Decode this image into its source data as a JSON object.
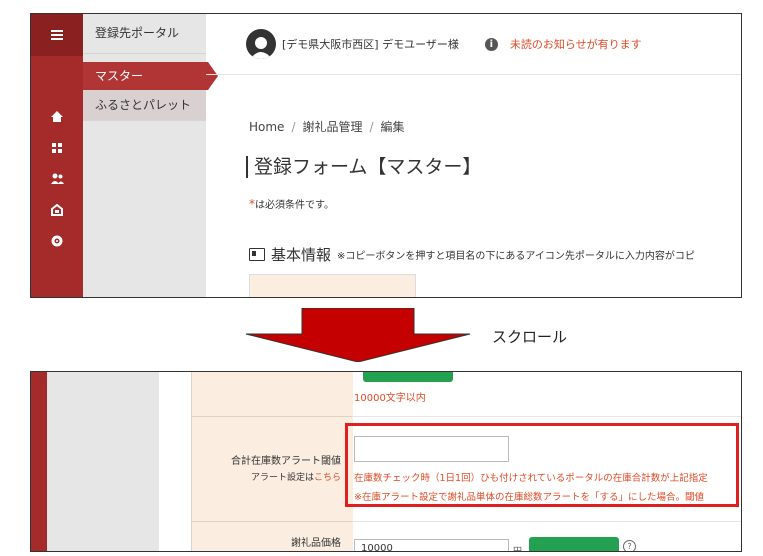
{
  "top": {
    "sidebar": {
      "portal_label": "登録先ポータル",
      "active_item": "マスター",
      "sub_item": "ふるさとパレット",
      "icons": [
        "menu-icon",
        "home-icon",
        "grid-icon",
        "users-icon",
        "portal-icon",
        "gear-icon"
      ]
    },
    "header": {
      "user_name": "[デモ県大阪市西区] デモユーザー様",
      "info_glyph": "i",
      "notice": "未読のお知らせが有ります"
    },
    "breadcrumb": {
      "home": "Home",
      "sep": "/",
      "item1": "謝礼品管理",
      "item2": "編集"
    },
    "page_title": "登録フォーム【マスター】",
    "required_star": "*",
    "required_note": "は必須条件です。",
    "section": {
      "title": "基本情報",
      "note": "※コピーボタンを押すと項目名の下にあるアイコン先ポータルに入力内容がコピ"
    }
  },
  "annotation": {
    "scroll_label": "スクロール"
  },
  "bottom": {
    "limit_text": "10000文字以内",
    "alert_field": {
      "label": "合計在庫数アラート閾値",
      "sublabel_prefix": "アラート設定は",
      "sublabel_link": "こちら",
      "value": "",
      "help1": "在庫数チェック時（1日1回）ひも付けされているポータルの在庫合計数が上記指定",
      "help2": "※在庫アラート設定で謝礼品単体の在庫総数アラートを「する」にした場合。閾値"
    },
    "price_field": {
      "label": "謝礼品価格",
      "value": "10000",
      "unit": "円",
      "help_glyph": "?"
    }
  },
  "colors": {
    "sidebar_red": "#a52a2a",
    "accent_red": "#e24b26",
    "green": "#24a150",
    "label_bg": "#fbeee0"
  }
}
